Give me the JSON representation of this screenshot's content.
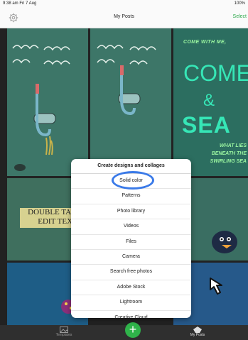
{
  "status_bar": {
    "time": "9:38 am  Fri 7 Aug",
    "battery": "100%"
  },
  "nav": {
    "title": "My Posts",
    "select_label": "Select"
  },
  "tiles": {
    "come_small": "COME WITH ME,",
    "come_big": "COME",
    "ampersand": "&",
    "sea": "SEA",
    "beneath": "WHAT LIES BENEATH THE SWIRLING SEA",
    "double_tap": "DOUBLE TAP TO EDIT TEXT"
  },
  "menu": {
    "header": "Create designs and collages",
    "items": [
      "Solid color",
      "Patterns",
      "Photo library",
      "Videos",
      "Files",
      "Camera",
      "Search free photos",
      "Adobe Stock",
      "Lightroom",
      "Creative Cloud"
    ]
  },
  "tabbar": {
    "templates_label": "Templates",
    "posts_label": "My Posts",
    "add_label": "+"
  },
  "colors": {
    "accent": "#2fb34a",
    "highlight": "#3a7ae8"
  }
}
